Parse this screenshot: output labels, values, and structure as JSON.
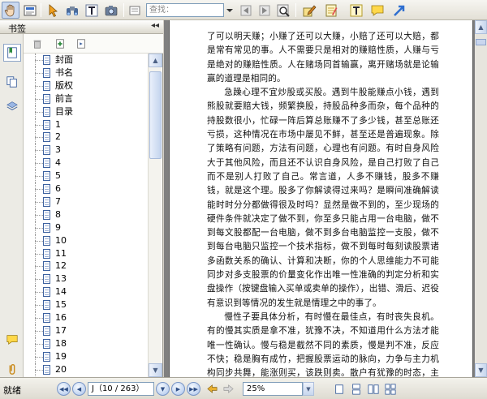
{
  "toolbar": {
    "find_placeholder": "查找：",
    "items": [
      "hand-tool",
      "select-text",
      "select-arrow",
      "find",
      "text-tool",
      "snapshot",
      "previous-result",
      "next-result",
      "search",
      "highlight",
      "note",
      "typewriter",
      "comment",
      "arrow"
    ]
  },
  "sidebar": {
    "title": "书签",
    "collapse_glyph": "◂◂",
    "bookmarks": [
      "封面",
      "书名",
      "版权",
      "前言",
      "目录",
      "1",
      "2",
      "3",
      "4",
      "5",
      "6",
      "7",
      "8",
      "9",
      "10",
      "11",
      "12",
      "13",
      "14",
      "15",
      "16",
      "17",
      "18",
      "19",
      "20"
    ]
  },
  "document": {
    "paragraphs": [
      {
        "indent": false,
        "text": "了可以明天赚；小赚了还可以大赚，小赔了还可以大赔，都是常有常见的事。人不需要只是相对的赚赔性质，人赚与亏是绝对的赚赔性质。人在赌场同首输赢，离开赌场就是论输赢的道理是相同的。"
      },
      {
        "indent": true,
        "text": "急躁心理不宜炒股或买股。遇到牛股能赚点小钱，遇到熊股就要赔大钱，频繁换股，持股品种多而杂，每个品种的持股数很小，忙碌一阵后算总账赚不了多少钱，甚至总账还亏损，这种情况在市场中屡见不鲜，甚至还是普遍现象。除了策略有问题，方法有问题，心理也有问题。有时自身风险大于其他风险，而且还不认识自身风险，是自己打败了自己而不是别人打败了自己。常言道，人多不赚钱，股多不赚钱，就是这个理。股多了你解读得过来吗？是瞬间准确解读能时时分分都做得很及时吗？显然是做不到的，至少现场的硬件条件就决定了做不到，你至多只能占用一台电脑，做不到每文股都配一台电脑，做不到多台电脑监控一支股，做不到每台电脑只监控一个技术指标，做不到每时每刻读股票诸多函数关系的确认、计算和决断，你的个人思维能力不可能同步对多支股票的价量变化作出唯一性准确的判定分析和实盘操作（按键盘输入买单或卖单的操作），出错、滑后、迟役有意识到等情况的发生就是情理之中的事了。"
      },
      {
        "indent": true,
        "text": "慢性子要具体分析，有时慢在最佳点，有时丧失良机。有的慢其实质是拿不准，犹豫不决，不知道用什么方法才能唯一性确认。慢与稳是截然不同的素质，慢是判不准，反应不快；稳是胸有成竹，把握股票运动的脉向，力争与主力机构同步共舞，能涨则买，该跌则卖。散户有犹豫的时态，主力机构同样有犹豫的时态，而且犹豫的程度和时间段比散户更甚，是因为仓位重、心理压力大、股价位起来后，还敢不"
      }
    ]
  },
  "status": {
    "ready_text": "就绪",
    "page_indicator": "J（10 / 263）",
    "zoom": "25%"
  },
  "colors": {
    "accent": "#7b95bd",
    "page_background": "#808080",
    "chrome": "#d4d0c8"
  }
}
